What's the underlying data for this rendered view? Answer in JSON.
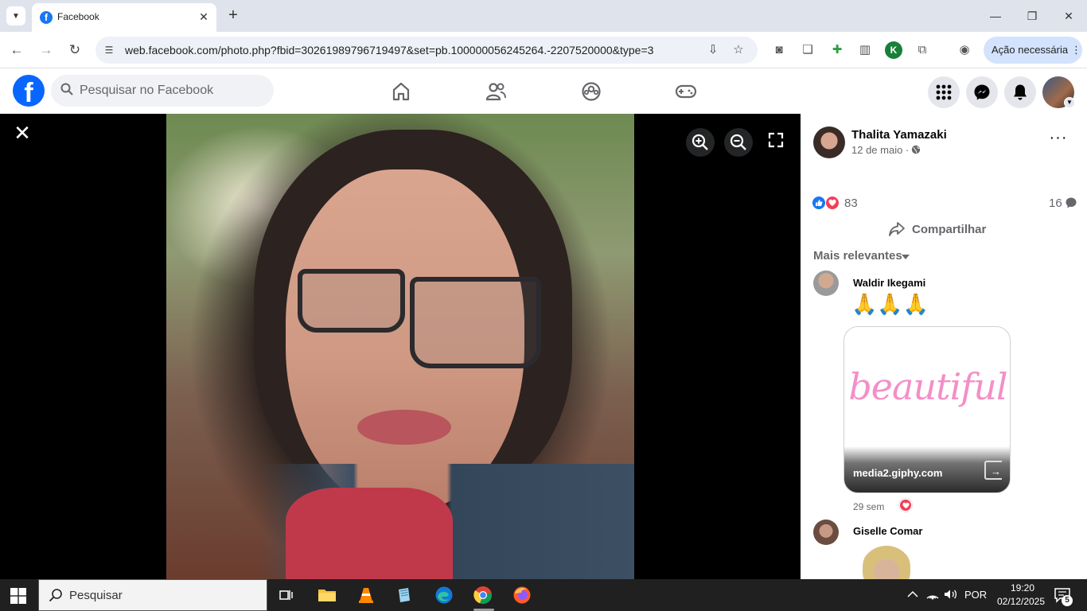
{
  "browser": {
    "tab_title": "Facebook",
    "tab_favicon": "f",
    "address_url": "web.facebook.com/photo.php?fbid=30261989796719497&set=pb.100000056245264.-2207520000&type=3",
    "action_button": "Ação necessária",
    "extension_k": "K"
  },
  "facebook": {
    "logo_letter": "f",
    "search_placeholder": "Pesquisar no Facebook",
    "brand_color": "#0866ff"
  },
  "post": {
    "author_name": "Thalita Yamazaki",
    "date": "12 de maio ·",
    "reaction_count": "83",
    "comment_count": "16",
    "share_label": "Compartilhar",
    "sort_label": "Mais relevantes"
  },
  "comments": [
    {
      "name": "Waldir Ikegami",
      "text": "🙏🙏🙏",
      "gif_text": "beautiful",
      "gif_source": "media2.giphy.com",
      "time": "29 sem"
    },
    {
      "name": "Giselle Comar"
    }
  ],
  "taskbar": {
    "search_placeholder": "Pesquisar",
    "language": "POR",
    "time": "19:20",
    "date": "02/12/2025",
    "notification_count": "5"
  }
}
